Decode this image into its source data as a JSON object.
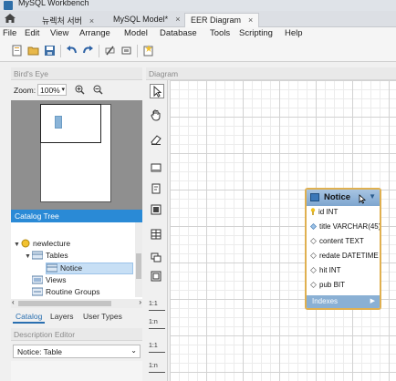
{
  "window": {
    "title": "MySQL Workbench"
  },
  "tabs": [
    {
      "label": "뉴렉처 서버",
      "close": "×"
    },
    {
      "label": "MySQL Model*",
      "close": "×"
    },
    {
      "label": "EER Diagram",
      "close": "×"
    }
  ],
  "menu": [
    "File",
    "Edit",
    "View",
    "Arrange",
    "Model",
    "Database",
    "Tools",
    "Scripting",
    "Help"
  ],
  "toolbar": {
    "icons": [
      "new-document-icon",
      "open-folder-icon",
      "save-icon",
      "undo-icon",
      "redo-icon",
      "toggle-grid-icon",
      "align-grid-icon",
      "new-diagram-icon"
    ]
  },
  "birds_eye": {
    "header": "Bird's Eye",
    "zoom_label": "Zoom:",
    "zoom_value": "100%"
  },
  "catalog": {
    "header": "Catalog Tree",
    "items": [
      {
        "label": "newlecture",
        "level": 0
      },
      {
        "label": "Tables",
        "level": 1
      },
      {
        "label": "Notice",
        "level": 2
      },
      {
        "label": "Views",
        "level": 1
      },
      {
        "label": "Routine Groups",
        "level": 1
      }
    ]
  },
  "bottom_tabs": [
    "Catalog",
    "Layers",
    "User Types"
  ],
  "description_editor": {
    "header": "Description Editor",
    "selected": "Notice: Table"
  },
  "palette": {
    "relationships": [
      "1:1",
      "1:n",
      "1:1",
      "1:n"
    ]
  },
  "diagram": {
    "header": "Diagram",
    "entity": {
      "name": "Notice",
      "columns": [
        {
          "label": "id INT",
          "key": "primary"
        },
        {
          "label": "title VARCHAR(45)",
          "key": "column"
        },
        {
          "label": "content TEXT",
          "key": "column"
        },
        {
          "label": "redate DATETIME",
          "key": "column"
        },
        {
          "label": "hit INT",
          "key": "column"
        },
        {
          "label": "pub BIT",
          "key": "column"
        }
      ],
      "footer": "Indexes"
    }
  },
  "colors": {
    "accent": "#2a8ad6",
    "entity_border": "#e0b050",
    "entity_header": "#7ea6cf"
  }
}
